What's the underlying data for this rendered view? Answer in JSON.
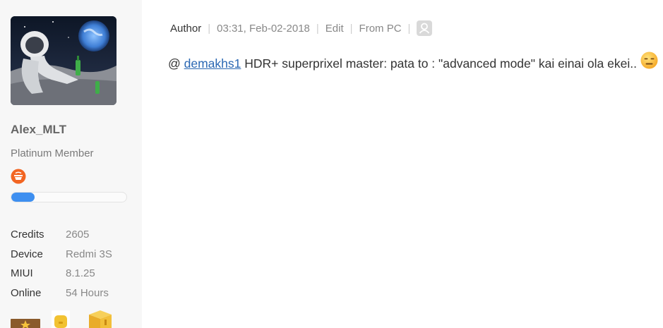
{
  "user": {
    "name": "Alex_MLT",
    "rank": "Platinum Member",
    "level_progress": 0.2,
    "stats": [
      {
        "label": "Credits",
        "value": "2605"
      },
      {
        "label": "Device",
        "value": "Redmi 3S"
      },
      {
        "label": "MIUI",
        "value": "8.1.25"
      },
      {
        "label": "Online",
        "value": "54 Hours"
      }
    ]
  },
  "post": {
    "author_label": "Author",
    "timestamp": "03:31, Feb-02-2018",
    "edit_label": "Edit",
    "source": "From PC",
    "mention_prefix": "@ ",
    "mention": "demakhs1",
    "body": " HDR+ superprixel master: pata to : \"advanced mode\" kai einai ola ekei.. "
  },
  "colors": {
    "accent": "#3e8ff0",
    "mention_link": "#2b68b3",
    "rank_badge": "#f26522",
    "sidebar_bg": "#f7f7f7"
  },
  "icons": {
    "rank_badge": "rank-badge-icon",
    "user": "user-icon",
    "emoji": "expressionless-face-emoji",
    "medals": [
      "star-medal-icon",
      "coin-medal-icon",
      "gift-box-medal-icon"
    ]
  }
}
